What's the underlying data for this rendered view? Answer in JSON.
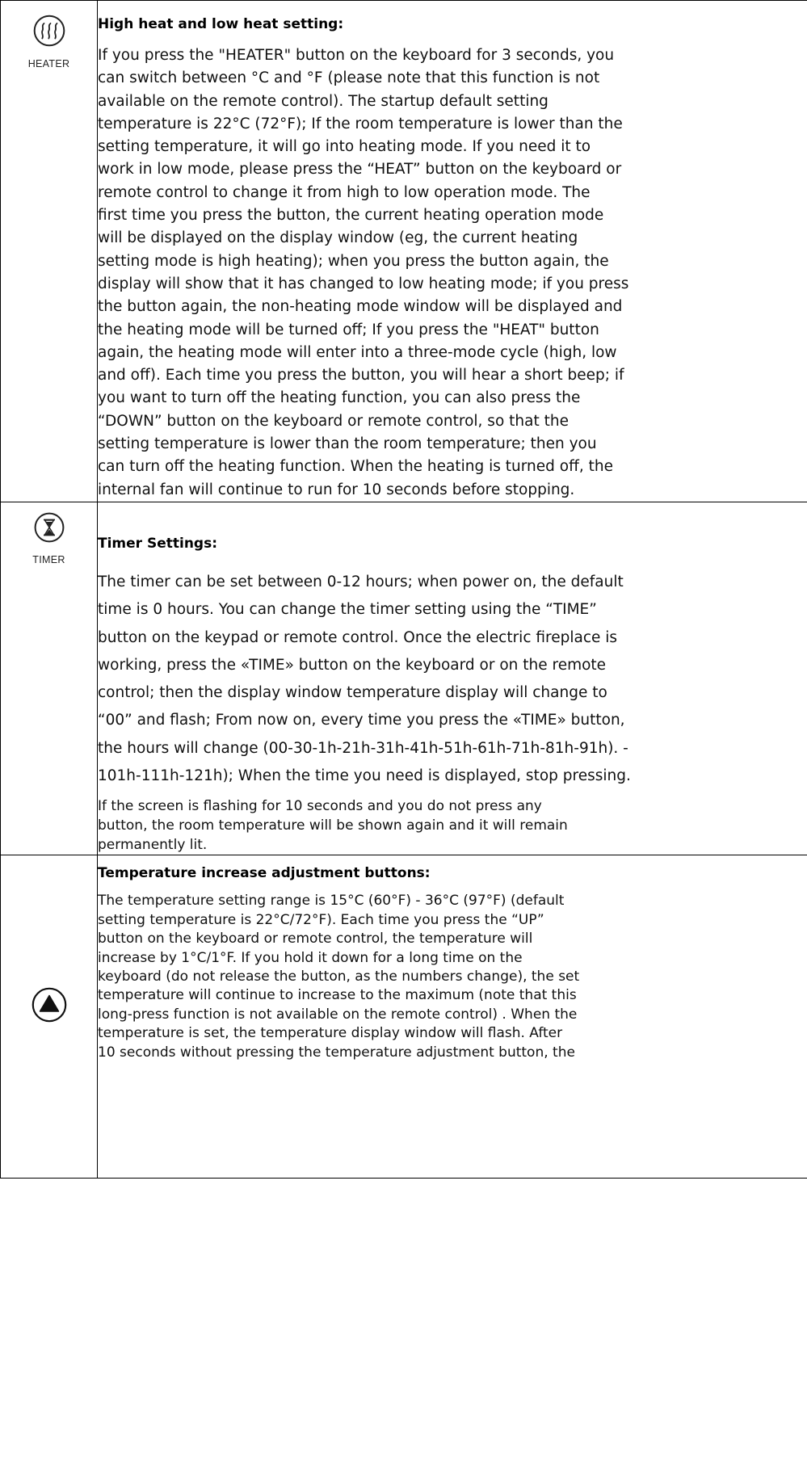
{
  "sections": [
    {
      "icon": "heater-wave-icon",
      "icon_label": "HEATER",
      "title": "High heat and low heat setting:",
      "lines": [
        "If you press the \"HEATER\" button on the keyboard for 3 seconds, you",
        "can switch between °C and °F (please note that this function is not",
        "available on the remote control). The startup default setting",
        "temperature is 22°C (72°F); If the room temperature is lower than the",
        "setting temperature, it will go into heating mode. If you need it to",
        "work in low mode, please press the “HEAT” button on the keyboard or",
        "remote control to change it from high to low operation mode. The",
        "first time you press the button, the current heating operation mode",
        "will be displayed on the display window (eg, the current heating",
        "setting mode is high heating); when you press the button again, the",
        "display will show that it has changed to low heating mode; if you press",
        "the button again, the non-heating mode window will be displayed and",
        "the heating mode will be turned off; If you press the \"HEAT\" button",
        "again, the heating mode will enter into a three-mode cycle (high, low",
        "and off). Each time you press the button, you will hear a short beep; if",
        "you want to turn off the heating function, you can also press the",
        "“DOWN” button on the keyboard or remote control, so that the",
        "setting temperature is lower than the room temperature; then you",
        "can turn off the heating function. When the heating is turned off, the",
        "internal fan will continue to run for 10 seconds before stopping."
      ]
    },
    {
      "icon": "hourglass-icon",
      "icon_label": "TIMER",
      "title": "Timer Settings:",
      "lines": [
        "The timer can be set between 0-12 hours; when power on, the default",
        "time is 0 hours. You can change the timer setting using the “TIME”",
        "button on the keypad or remote control. Once the electric fireplace is",
        "working, press the «TIME» button on the keyboard or on the remote",
        "control; then the display window temperature display will change to",
        "“00” and flash; From now on, every time you press the «TIME» button,",
        "the hours will change (00-30-1h-21h-31h-41h-51h-61h-71h-81h-91h). -",
        "101h-111h-121h); When the time you need is displayed, stop pressing."
      ],
      "note_lines": [
        "If the screen is flashing for 10 seconds and you do not press any",
        "button, the room temperature will be shown again and it will remain",
        "permanently lit."
      ]
    },
    {
      "icon": "up-triangle-icon",
      "icon_label": "",
      "title": "Temperature increase adjustment buttons:",
      "lines": [
        "The temperature setting range is 15°C (60°F) - 36°C (97°F) (default",
        "setting temperature is 22°C/72°F). Each time you press the “UP”",
        "button on the keyboard or remote control, the temperature will",
        "increase by 1°C/1°F. If you hold it down for a long time on the",
        "keyboard (do not release the button, as the numbers change), the set",
        "temperature will continue to increase to the maximum (note that this",
        "long-press function is not available on the remote control) . When the",
        "temperature is set, the temperature display window will flash. After",
        "10 seconds without pressing the temperature adjustment button, the"
      ]
    }
  ]
}
